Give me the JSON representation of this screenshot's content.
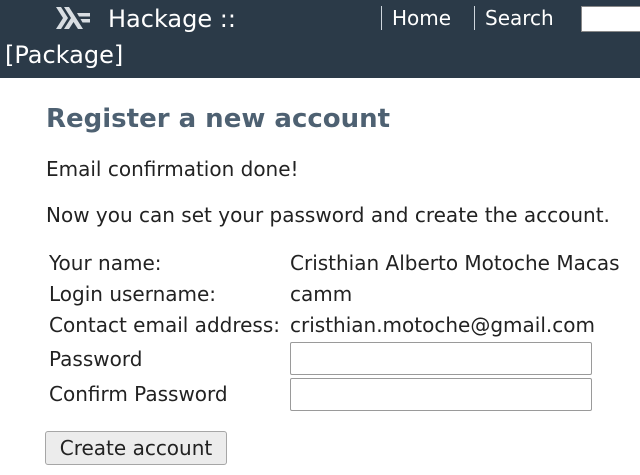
{
  "header": {
    "logo_icon": "haskell-logo-icon",
    "title": "Hackage ::",
    "subtitle": "[Package]",
    "nav": {
      "home": "Home",
      "search": "Search"
    },
    "search_placeholder": ""
  },
  "main": {
    "title": "Register a new account",
    "confirmation": "Email confirmation done!",
    "instruction": "Now you can set your password and create the account.",
    "form": {
      "name_label": "Your name:",
      "name_value": "Cristhian Alberto Motoche Macas",
      "username_label": "Login username:",
      "username_value": "camm",
      "email_label": "Contact email address:",
      "email_value": "cristhian.motoche@gmail.com",
      "password_label": "Password",
      "password_value": "",
      "confirm_label": "Confirm Password",
      "confirm_value": "",
      "submit_label": "Create account"
    }
  },
  "colors": {
    "header_bg": "#2b3a48",
    "title_color": "#4e6172"
  }
}
